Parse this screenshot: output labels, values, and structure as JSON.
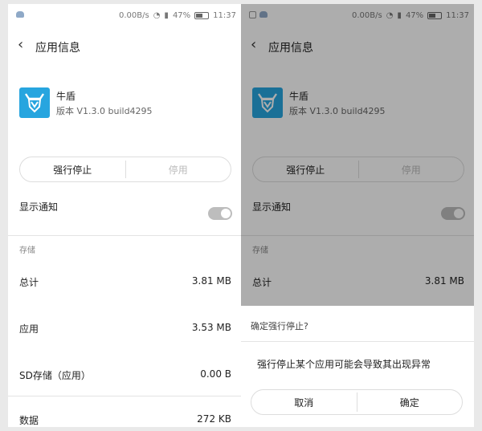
{
  "status_bar": {
    "speed": "0.00B/s",
    "battery": "47%",
    "time": "11:37"
  },
  "app_info": {
    "header_title": "应用信息",
    "app_name": "牛盾",
    "version": "版本 V1.3.0 build4295",
    "force_stop_label": "强行停止",
    "disable_label": "停用",
    "show_notification_label": "显示通知",
    "notification_enabled": true,
    "storage_section": "存储",
    "storage_rows": [
      {
        "label": "总计",
        "value": "3.81 MB"
      },
      {
        "label": "应用",
        "value": "3.53 MB"
      },
      {
        "label": "SD存储（应用）",
        "value": "0.00 B"
      },
      {
        "label": "数据",
        "value": "272 KB"
      }
    ]
  },
  "dialog": {
    "title": "确定强行停止?",
    "message": "强行停止某个应用可能会导致其出现异常",
    "cancel_label": "取消",
    "confirm_label": "确定"
  },
  "colors": {
    "app_icon_bg": "#27a5df",
    "toggle_off": "#bdbdbd",
    "overlay": "rgba(0,0,0,0.32)"
  }
}
